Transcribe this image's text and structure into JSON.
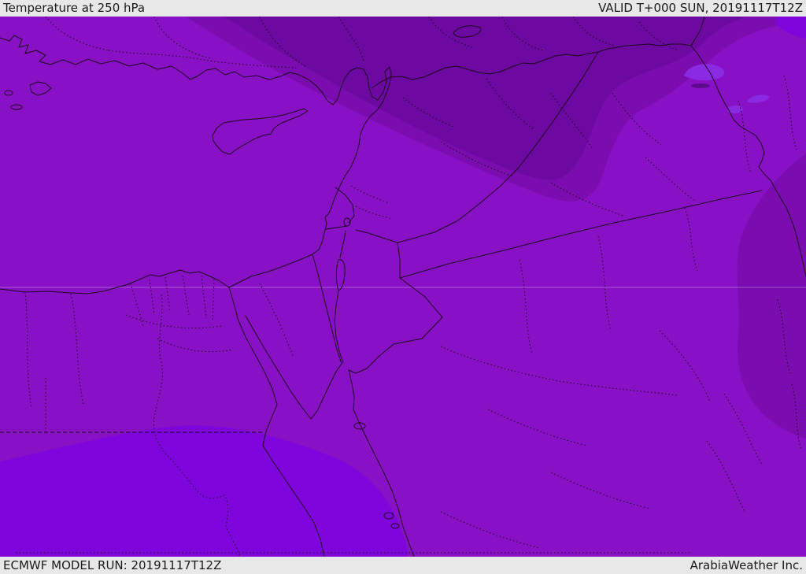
{
  "header": {
    "title": "Temperature at 250 hPa",
    "valid_label": "VALID T+000 SUN, 20191117T12Z"
  },
  "footer": {
    "model_run": "ECMWF MODEL RUN: 20191117T12Z",
    "credit": "ArabiaWeather Inc."
  },
  "map": {
    "colors": {
      "base": "#8911c5",
      "band_cool": "#7a0cb0",
      "band_coolest": "#6c09a0",
      "band_warm": "#7e06dc",
      "lake_warm": "#8a2ae2",
      "shadow": "#5e0a8e",
      "stroke": "#1c041c",
      "gridline": "#ffffff"
    }
  }
}
